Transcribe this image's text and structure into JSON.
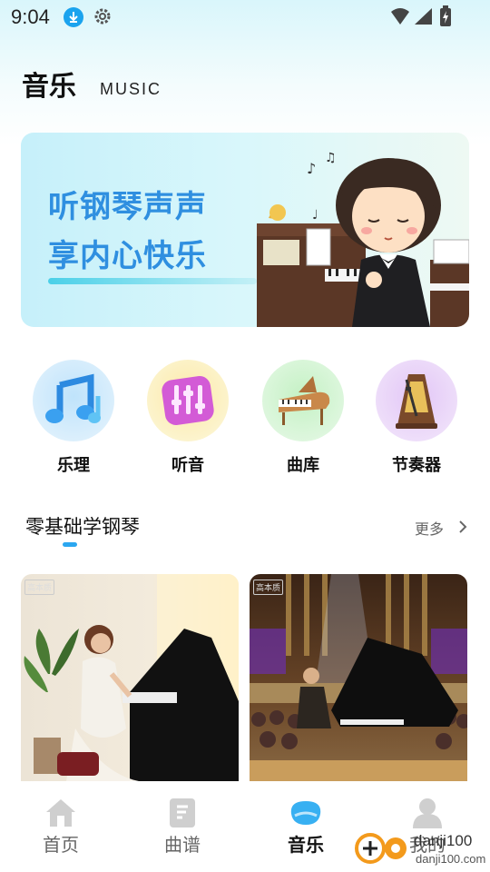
{
  "status_bar": {
    "time": "9:04"
  },
  "header": {
    "title": "音乐",
    "subtitle": "MUSIC"
  },
  "banner": {
    "line1": "听钢琴声声",
    "line2": "享内心快乐"
  },
  "categories": [
    {
      "label": "乐理",
      "icon": "music-notes-icon",
      "color": "#d5ecfb"
    },
    {
      "label": "听音",
      "icon": "equalizer-icon",
      "color": "#fbf3c8"
    },
    {
      "label": "曲库",
      "icon": "grand-piano-icon",
      "color": "#d8f5d8"
    },
    {
      "label": "节奏器",
      "icon": "metronome-icon",
      "color": "#ecd9f7"
    }
  ],
  "section": {
    "title": "零基础学钢琴",
    "more": "更多"
  },
  "cards": [
    {
      "tag": "高本质",
      "image": "woman-playing-piano-photo"
    },
    {
      "tag": "高本质",
      "image": "concert-hall-pianist-photo"
    }
  ],
  "bottom_nav": [
    {
      "label": "首页",
      "icon": "home-icon",
      "active": false
    },
    {
      "label": "曲谱",
      "icon": "sheet-music-icon",
      "active": false
    },
    {
      "label": "音乐",
      "icon": "music-nav-icon",
      "active": true
    },
    {
      "label": "我的",
      "icon": "user-icon",
      "active": false
    }
  ],
  "watermark": {
    "text1": "danji100",
    "text2": "danji100.com"
  },
  "colors": {
    "accent": "#2ba7f0",
    "banner_text": "#2f8fe0"
  }
}
